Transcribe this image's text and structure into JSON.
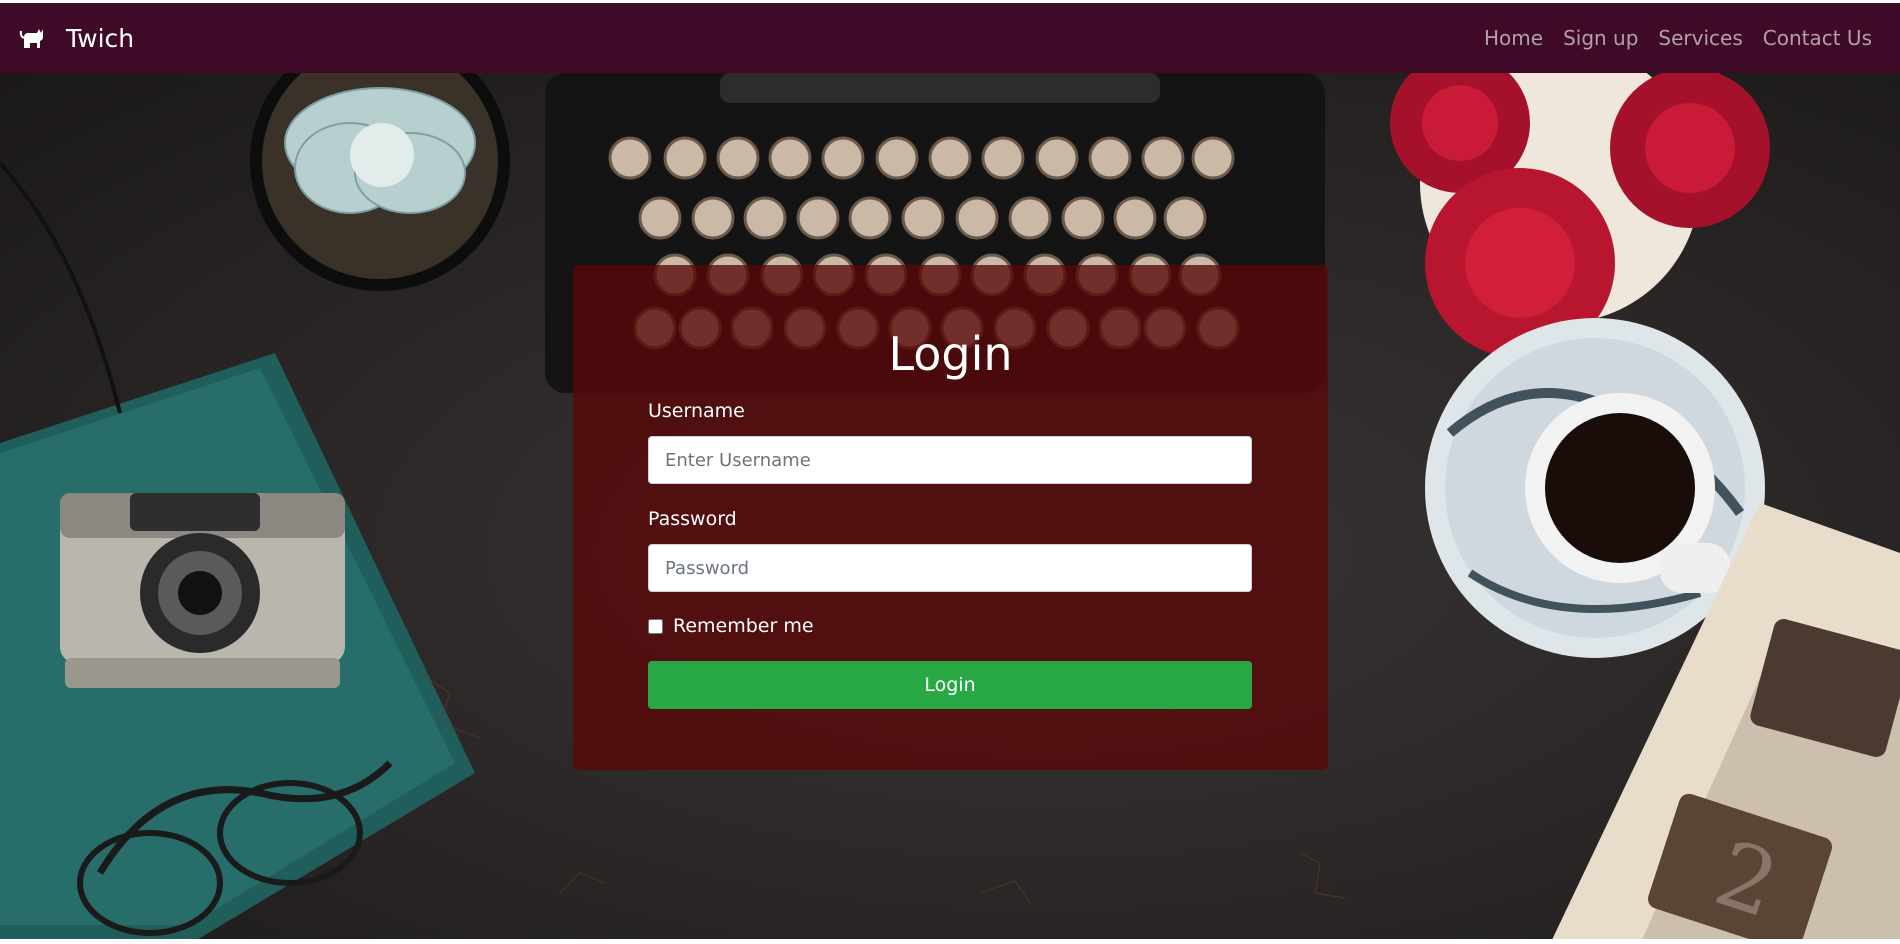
{
  "navbar": {
    "brand": "Twich",
    "links": [
      "Home",
      "Sign up",
      "Services",
      "Contact Us"
    ]
  },
  "login": {
    "title": "Login",
    "username_label": "Username",
    "username_placeholder": "Enter Username",
    "password_label": "Password",
    "password_placeholder": "Password",
    "remember_label": "Remember me",
    "submit_label": "Login"
  },
  "colors": {
    "navbar": "#3f0a27",
    "card": "#5a0608",
    "button": "#28a745",
    "nav_link": "rgba(255,255,255,0.6)"
  },
  "icons": {
    "brand": "cat-icon"
  }
}
